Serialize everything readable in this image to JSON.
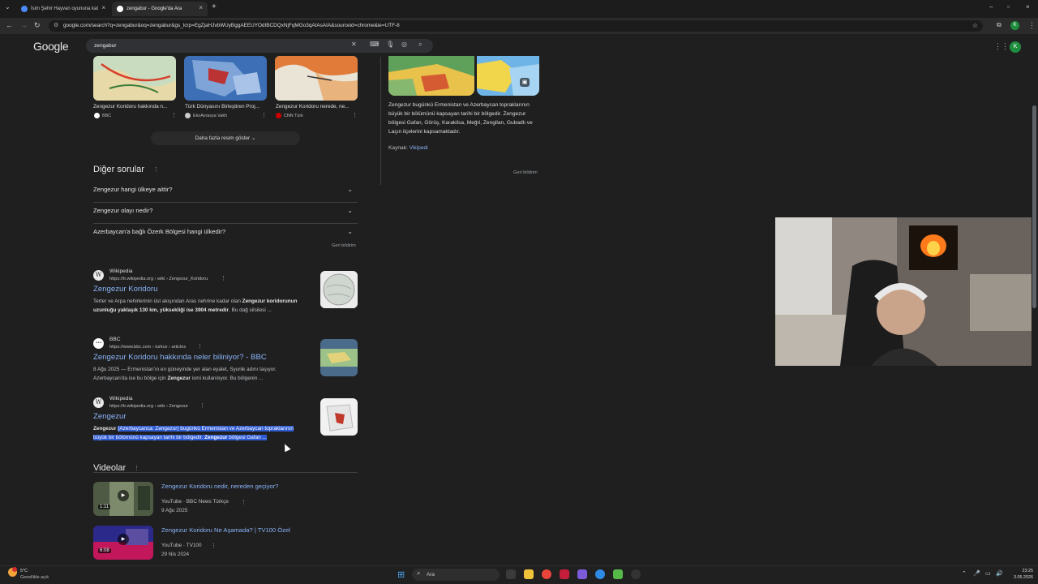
{
  "browser": {
    "tabs": [
      {
        "label": "İsim Şehir Hayvan oyununa kat",
        "active": false
      },
      {
        "label": "zengabur - Google'da Ara",
        "active": true
      }
    ],
    "new_tab_label": "+",
    "url": "google.com/search?q=zengabur&oq=zengabur&gs_lcrp=EgZjaHJvbWUyBggAEEUYOdIBCDQxNjFqMGo3qAIAsAIA&sourceid=chrome&ie=UTF-8"
  },
  "google": {
    "logo": "Google",
    "query": "zengabur",
    "avatar_letter": "K"
  },
  "images": {
    "cards": [
      {
        "caption": "Zengezur Koridoru hakkında n...",
        "source": "BBC",
        "source_color": "#ffffff"
      },
      {
        "caption": "Türk Dünyasını Birleştiren Proj...",
        "source": "EkoAvrasya Vakfı",
        "source_color": "#d0d0d0"
      },
      {
        "caption": "Zengezur Koridoru nerede, ne...",
        "source": "CNN Türk",
        "source_color": "#cc0000"
      }
    ],
    "more_label": "Daha fazla resim göster"
  },
  "other_questions": {
    "title": "Diğer sorular",
    "items": [
      "Zengezur hangi ülkeye aittir?",
      "Zengezur olayı nedir?",
      "Azerbaycan'a bağlı Özerk Bölgesi hangi ülkedir?"
    ],
    "feedback": "Geri bildirim"
  },
  "results": [
    {
      "site": "Wikipedia",
      "url": "https://tr.wikipedia.org › wiki › Zengezur_Koridoru",
      "favicon": "W",
      "title": "Zengezur Koridoru",
      "snippet_html": "Terter ve Arpa nehirlerinin üst akışından Aras nehrine kadar olan <b>Zengezur koridorunun uzunluğu yaklaşık 130 km, yüksekliği ise 3904 metredir</b>. Bu dağ silsilesi ..."
    },
    {
      "site": "BBC",
      "url": "https://www.bbc.com › turkce › articles",
      "favicon": "•••",
      "title": "Zengezur Koridoru hakkında neler biliniyor? - BBC",
      "snippet_html": "8 Ağu 2025 — Ermenistan'ın en güneyinde yer alan eyalet, Syunik adını taşıyor. Azerbaycan'da ise bu bölge için <b>Zengezur</b> ismi kullanılıyor. Bu bölgenin ..."
    },
    {
      "site": "Wikipedia",
      "url": "https://tr.wikipedia.org › wiki › Zengezur",
      "favicon": "W",
      "title": "Zengezur",
      "snippet_html": "<b>Zengezur</b> <span class=\"hl\">(Azerbaycanca: Zəngəzur) bugünkü Ermenistan ve Azerbaycan topraklarının büyük bir bölümünü kapsayan tarihi bir bölgedir. <b>Zengezur</b> bölgesi Gafan ...</span>"
    }
  ],
  "videos": {
    "title": "Videolar",
    "items": [
      {
        "title": "Zengezur Koridoru nedir, nereden geçiyor?",
        "channel": "YouTube · BBC News Türkçe",
        "date": "9 Ağu 2025",
        "duration": "1:11"
      },
      {
        "title": "Zengezur Koridoru Ne Aşamada? | TV100 Özel",
        "channel": "YouTube · TV100",
        "date": "29 Nis 2024",
        "duration": "6:08"
      }
    ]
  },
  "knowledge_panel": {
    "description": "Zengezur bugünkü Ermenistan ve Azerbaycan topraklarının büyük bir bölümünü kapsayan tarihi bir bölgedir. Zengezur bölgesi Gafan, Görüş, Karakilsa, Meğri, Zengilan, Gubadlı ve Laçın ilçelerini kapsamaktadır.",
    "source_label": "Kaynak:",
    "source_link": "Vikipedi",
    "feedback": "Geri bildirim"
  },
  "taskbar": {
    "weather_temp": "5°C",
    "weather_desc": "Genellikle açık",
    "search_placeholder": "Ara",
    "time": "23:25",
    "date": "3.05.2026"
  },
  "colors": {
    "background": "#1f1f1f",
    "link": "#8ab4f8",
    "highlight": "#2f5bd3",
    "avatar": "#1e8e3e"
  }
}
